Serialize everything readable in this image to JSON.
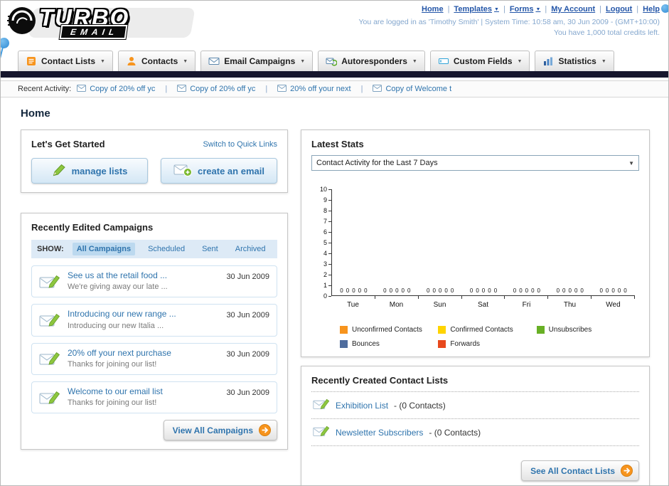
{
  "header": {
    "logo_line1": "TURBO",
    "logo_line2": "EMAIL",
    "nav_links": [
      {
        "label": "Home"
      },
      {
        "label": "Templates"
      },
      {
        "label": "Forms"
      },
      {
        "label": "My Account"
      },
      {
        "label": "Logout"
      },
      {
        "label": "Help"
      }
    ],
    "login_status": "You are logged in as 'Timothy Smith' | System Time: 10:58 am, 30 Jun 2009 - (GMT+10:00)",
    "credits": "You have 1,000 total credits left."
  },
  "main_nav": {
    "tabs": [
      {
        "label": "Contact Lists",
        "icon": "contact-lists-icon"
      },
      {
        "label": "Contacts",
        "icon": "contacts-icon"
      },
      {
        "label": "Email Campaigns",
        "icon": "email-campaigns-icon"
      },
      {
        "label": "Autoresponders",
        "icon": "autoresponders-icon"
      },
      {
        "label": "Custom Fields",
        "icon": "custom-fields-icon"
      },
      {
        "label": "Statistics",
        "icon": "statistics-icon"
      }
    ]
  },
  "recent_activity": {
    "label": "Recent Activity:",
    "items": [
      {
        "label": "Copy of 20% off yc"
      },
      {
        "label": "Copy of 20% off yc"
      },
      {
        "label": "20% off your next"
      },
      {
        "label": "Copy of Welcome t"
      }
    ]
  },
  "page": {
    "title": "Home"
  },
  "get_started": {
    "title": "Let's Get Started",
    "switch_link": "Switch to Quick Links",
    "manage_lists_button": "manage lists",
    "create_email_button": "create an email"
  },
  "campaigns": {
    "title": "Recently Edited Campaigns",
    "show_label": "SHOW:",
    "filters": [
      {
        "label": "All Campaigns",
        "active": true
      },
      {
        "label": "Scheduled",
        "active": false
      },
      {
        "label": "Sent",
        "active": false
      },
      {
        "label": "Archived",
        "active": false
      }
    ],
    "items": [
      {
        "title": "See us at the retail food ...",
        "subtitle": "We're giving away our late ...",
        "date": "30 Jun 2009"
      },
      {
        "title": "Introducing our new range ...",
        "subtitle": "Introducing our new Italia ...",
        "date": "30 Jun 2009"
      },
      {
        "title": "20% off your next purchase",
        "subtitle": "Thanks for joining our list!",
        "date": "30 Jun 2009"
      },
      {
        "title": "Welcome to our email list",
        "subtitle": "Thanks for joining our list!",
        "date": "30 Jun 2009"
      }
    ],
    "view_all_button": "View All Campaigns"
  },
  "latest_stats": {
    "title": "Latest Stats",
    "dropdown_value": "Contact Activity for the Last 7 Days"
  },
  "chart_data": {
    "type": "bar",
    "title": "Contact Activity for the Last 7 Days",
    "categories": [
      "Tue",
      "Mon",
      "Sun",
      "Sat",
      "Fri",
      "Thu",
      "Wed"
    ],
    "series": [
      {
        "name": "Unconfirmed Contacts",
        "color": "#f7941d",
        "values": [
          0,
          0,
          0,
          0,
          0,
          0,
          0
        ]
      },
      {
        "name": "Confirmed Contacts",
        "color": "#ffd400",
        "values": [
          0,
          0,
          0,
          0,
          0,
          0,
          0
        ]
      },
      {
        "name": "Unsubscribes",
        "color": "#68b025",
        "values": [
          0,
          0,
          0,
          0,
          0,
          0,
          0
        ]
      },
      {
        "name": "Bounces",
        "color": "#4f6d9e",
        "values": [
          0,
          0,
          0,
          0,
          0,
          0,
          0
        ]
      },
      {
        "name": "Forwards",
        "color": "#e8491d",
        "values": [
          0,
          0,
          0,
          0,
          0,
          0,
          0
        ]
      }
    ],
    "ylim": [
      0,
      10
    ],
    "ytick_step": 1,
    "grid": false,
    "legend_position": "bottom",
    "value_labels_shown": true
  },
  "contact_lists": {
    "title": "Recently Created Contact Lists",
    "items": [
      {
        "name": "Exhibition List",
        "suffix": "- (0 Contacts)"
      },
      {
        "name": "Newsletter Subscribers",
        "suffix": "- (0 Contacts)"
      }
    ],
    "see_all_button": "See All Contact Lists"
  },
  "icons": {
    "envelope": "envelope-icon",
    "pencil": "pencil-icon",
    "envelope_plus": "envelope-plus-icon",
    "envelope_pencil": "envelope-pencil-icon",
    "arrow_right_circle": "arrow-right-icon",
    "caret_down": "caret-down-icon",
    "dropdown_arrow": "dropdown-arrow-icon"
  }
}
